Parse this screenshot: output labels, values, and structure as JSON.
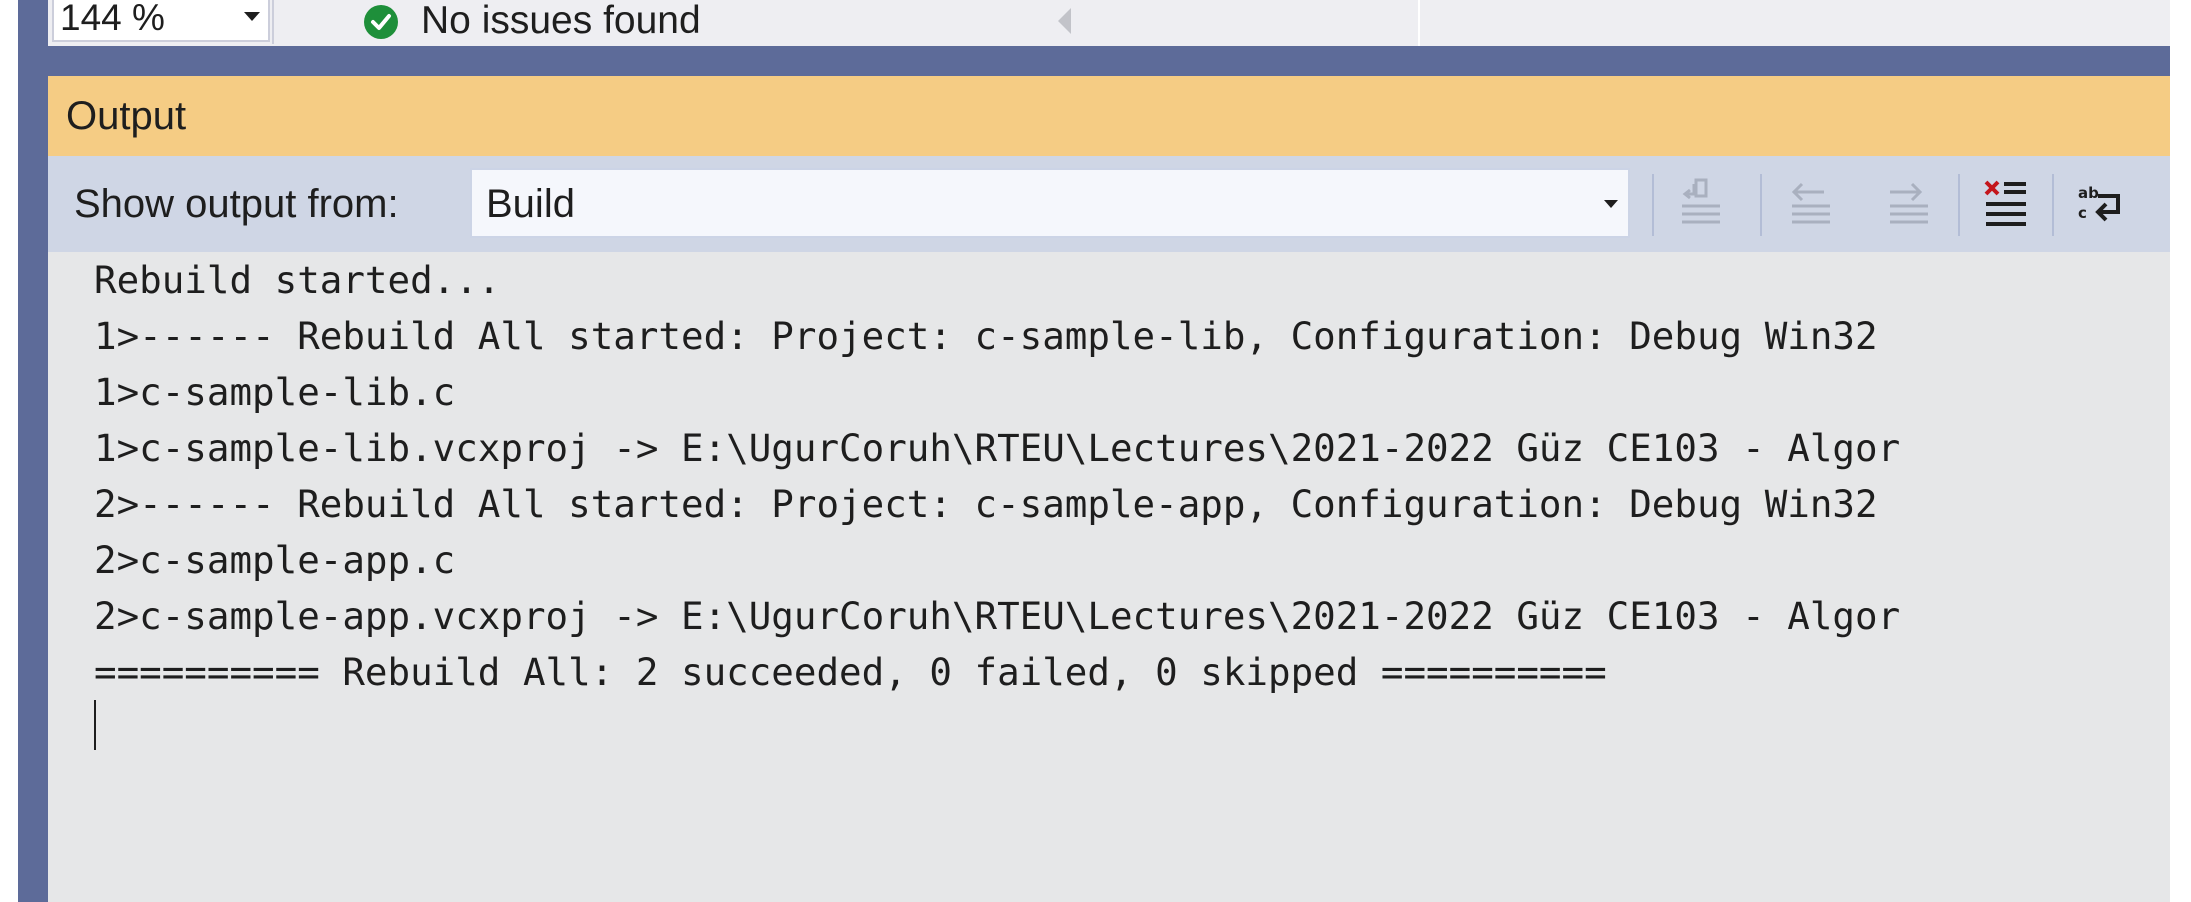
{
  "status_bar": {
    "zoom_value": "144 %",
    "issues_icon": "check-circle-icon",
    "issues_text": "No issues found",
    "scroll_icon": "scroll-left-arrow-icon"
  },
  "output_panel": {
    "title": "Output",
    "show_output_label": "Show output from:",
    "source_value": "Build",
    "toolbar_icons": [
      "find-message-in-code-icon",
      "go-to-previous-message-icon",
      "go-to-next-message-icon",
      "clear-all-icon",
      "toggle-word-wrap-icon"
    ],
    "lines": [
      "Rebuild started...",
      "1>------ Rebuild All started: Project: c-sample-lib, Configuration: Debug Win32",
      "1>c-sample-lib.c",
      "1>c-sample-lib.vcxproj -> E:\\UgurCoruh\\RTEU\\Lectures\\2021-2022 Güz CE103 - Algor",
      "2>------ Rebuild All started: Project: c-sample-app, Configuration: Debug Win32",
      "2>c-sample-app.c",
      "2>c-sample-app.vcxproj -> E:\\UgurCoruh\\RTEU\\Lectures\\2021-2022 Güz CE103 - Algor",
      "========== Rebuild All: 2 succeeded, 0 failed, 0 skipped =========="
    ]
  },
  "colors": {
    "title_bar": "#f5cc84",
    "toolbar": "#cfd6e5",
    "output_background": "#e6e7e8",
    "frame_blue": "#5d6b99",
    "success_green": "#1e8f3a",
    "clear_red": "#c4161c"
  }
}
